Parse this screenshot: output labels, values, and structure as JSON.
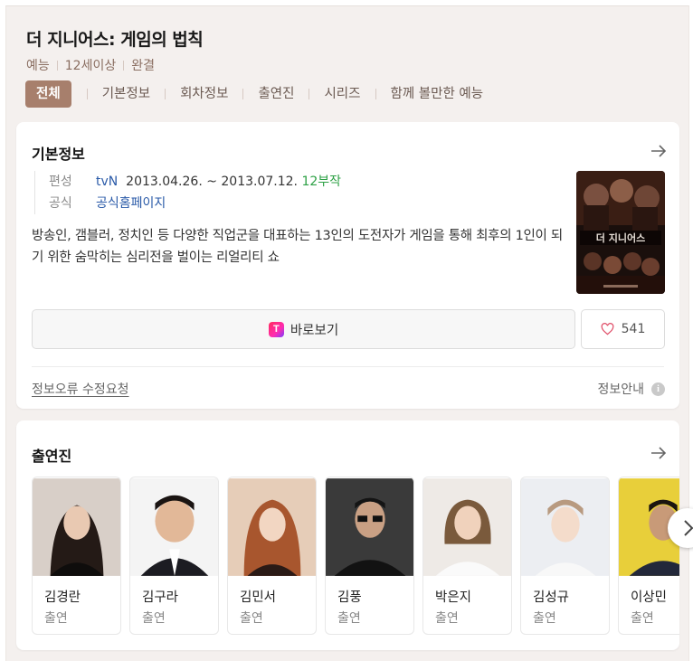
{
  "header": {
    "title": "더 지니어스: 게임의 법칙",
    "meta": [
      "예능",
      "12세이상",
      "완결"
    ]
  },
  "tabs": [
    "전체",
    "기본정보",
    "회차정보",
    "출연진",
    "시리즈",
    "함께 볼만한 예능"
  ],
  "basic_info": {
    "section_title": "기본정보",
    "rows": {
      "broadcast": {
        "key": "편성",
        "channel": "tvN",
        "dates": "2013.04.26. ~ 2013.07.12.",
        "episodes": "12부작"
      },
      "official": {
        "key": "공식",
        "value": "공식홈페이지"
      }
    },
    "description": "방송인, 갬블러, 정치인 등 다양한 직업군을 대표하는 13인의 도전자가 게임을 통해 최후의 1인이 되기 위한 숨막히는 심리전을 벌이는 리얼리티 쇼",
    "watch_label": "바로보기",
    "watch_logo": "T",
    "like_count": "541",
    "report_link": "정보오류 수정요청",
    "info_guide": "정보안내",
    "info_icon": "i"
  },
  "cast": {
    "section_title": "출연진",
    "members": [
      {
        "name": "김경란",
        "role": "출연"
      },
      {
        "name": "김구라",
        "role": "출연"
      },
      {
        "name": "김민서",
        "role": "출연"
      },
      {
        "name": "김풍",
        "role": "출연"
      },
      {
        "name": "박은지",
        "role": "출연"
      },
      {
        "name": "김성규",
        "role": "출연"
      },
      {
        "name": "이상민",
        "role": "출연"
      }
    ]
  },
  "colors": {
    "accent": "#a77f6c",
    "page_bg": "#f4f0ee",
    "link_blue": "#2a5aa8",
    "episode_green": "#2ca044"
  },
  "icons": [
    "arrow-right-icon",
    "heart-icon",
    "info-icon",
    "chevron-right-icon",
    "tving-logo-icon"
  ]
}
